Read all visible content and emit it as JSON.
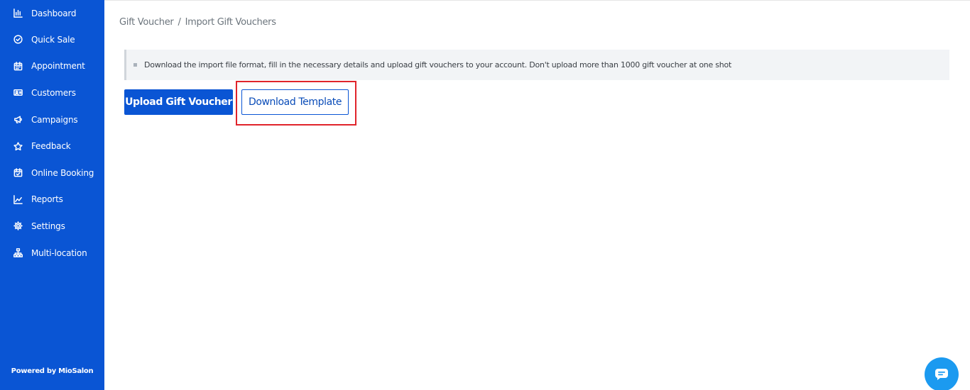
{
  "sidebar": {
    "items": [
      {
        "label": "Dashboard",
        "icon": "bar-chart-icon"
      },
      {
        "label": "Quick Sale",
        "icon": "check-circle-icon"
      },
      {
        "label": "Appointment",
        "icon": "calendar-icon"
      },
      {
        "label": "Customers",
        "icon": "users-icon"
      },
      {
        "label": "Campaigns",
        "icon": "megaphone-icon"
      },
      {
        "label": "Feedback",
        "icon": "star-icon"
      },
      {
        "label": "Online Booking",
        "icon": "calendar-check-icon"
      },
      {
        "label": "Reports",
        "icon": "line-chart-icon"
      },
      {
        "label": "Settings",
        "icon": "gear-icon"
      },
      {
        "label": "Multi-location",
        "icon": "sitemap-icon"
      }
    ],
    "powered_by": "Powered by MioSalon"
  },
  "breadcrumb": {
    "parent": "Gift Voucher",
    "separator": "/",
    "current": "Import Gift Vouchers"
  },
  "info": {
    "text": "Download the import file format, fill in the necessary details and upload gift vouchers to your account. Don't upload more than 1000 gift voucher at one shot"
  },
  "actions": {
    "upload_label": "Upload Gift Voucher",
    "download_label": "Download Template"
  },
  "colors": {
    "brand": "#0a55d4",
    "highlight": "#e0242b",
    "chat": "#1b9af0"
  },
  "chat": {
    "icon": "chat-icon"
  }
}
